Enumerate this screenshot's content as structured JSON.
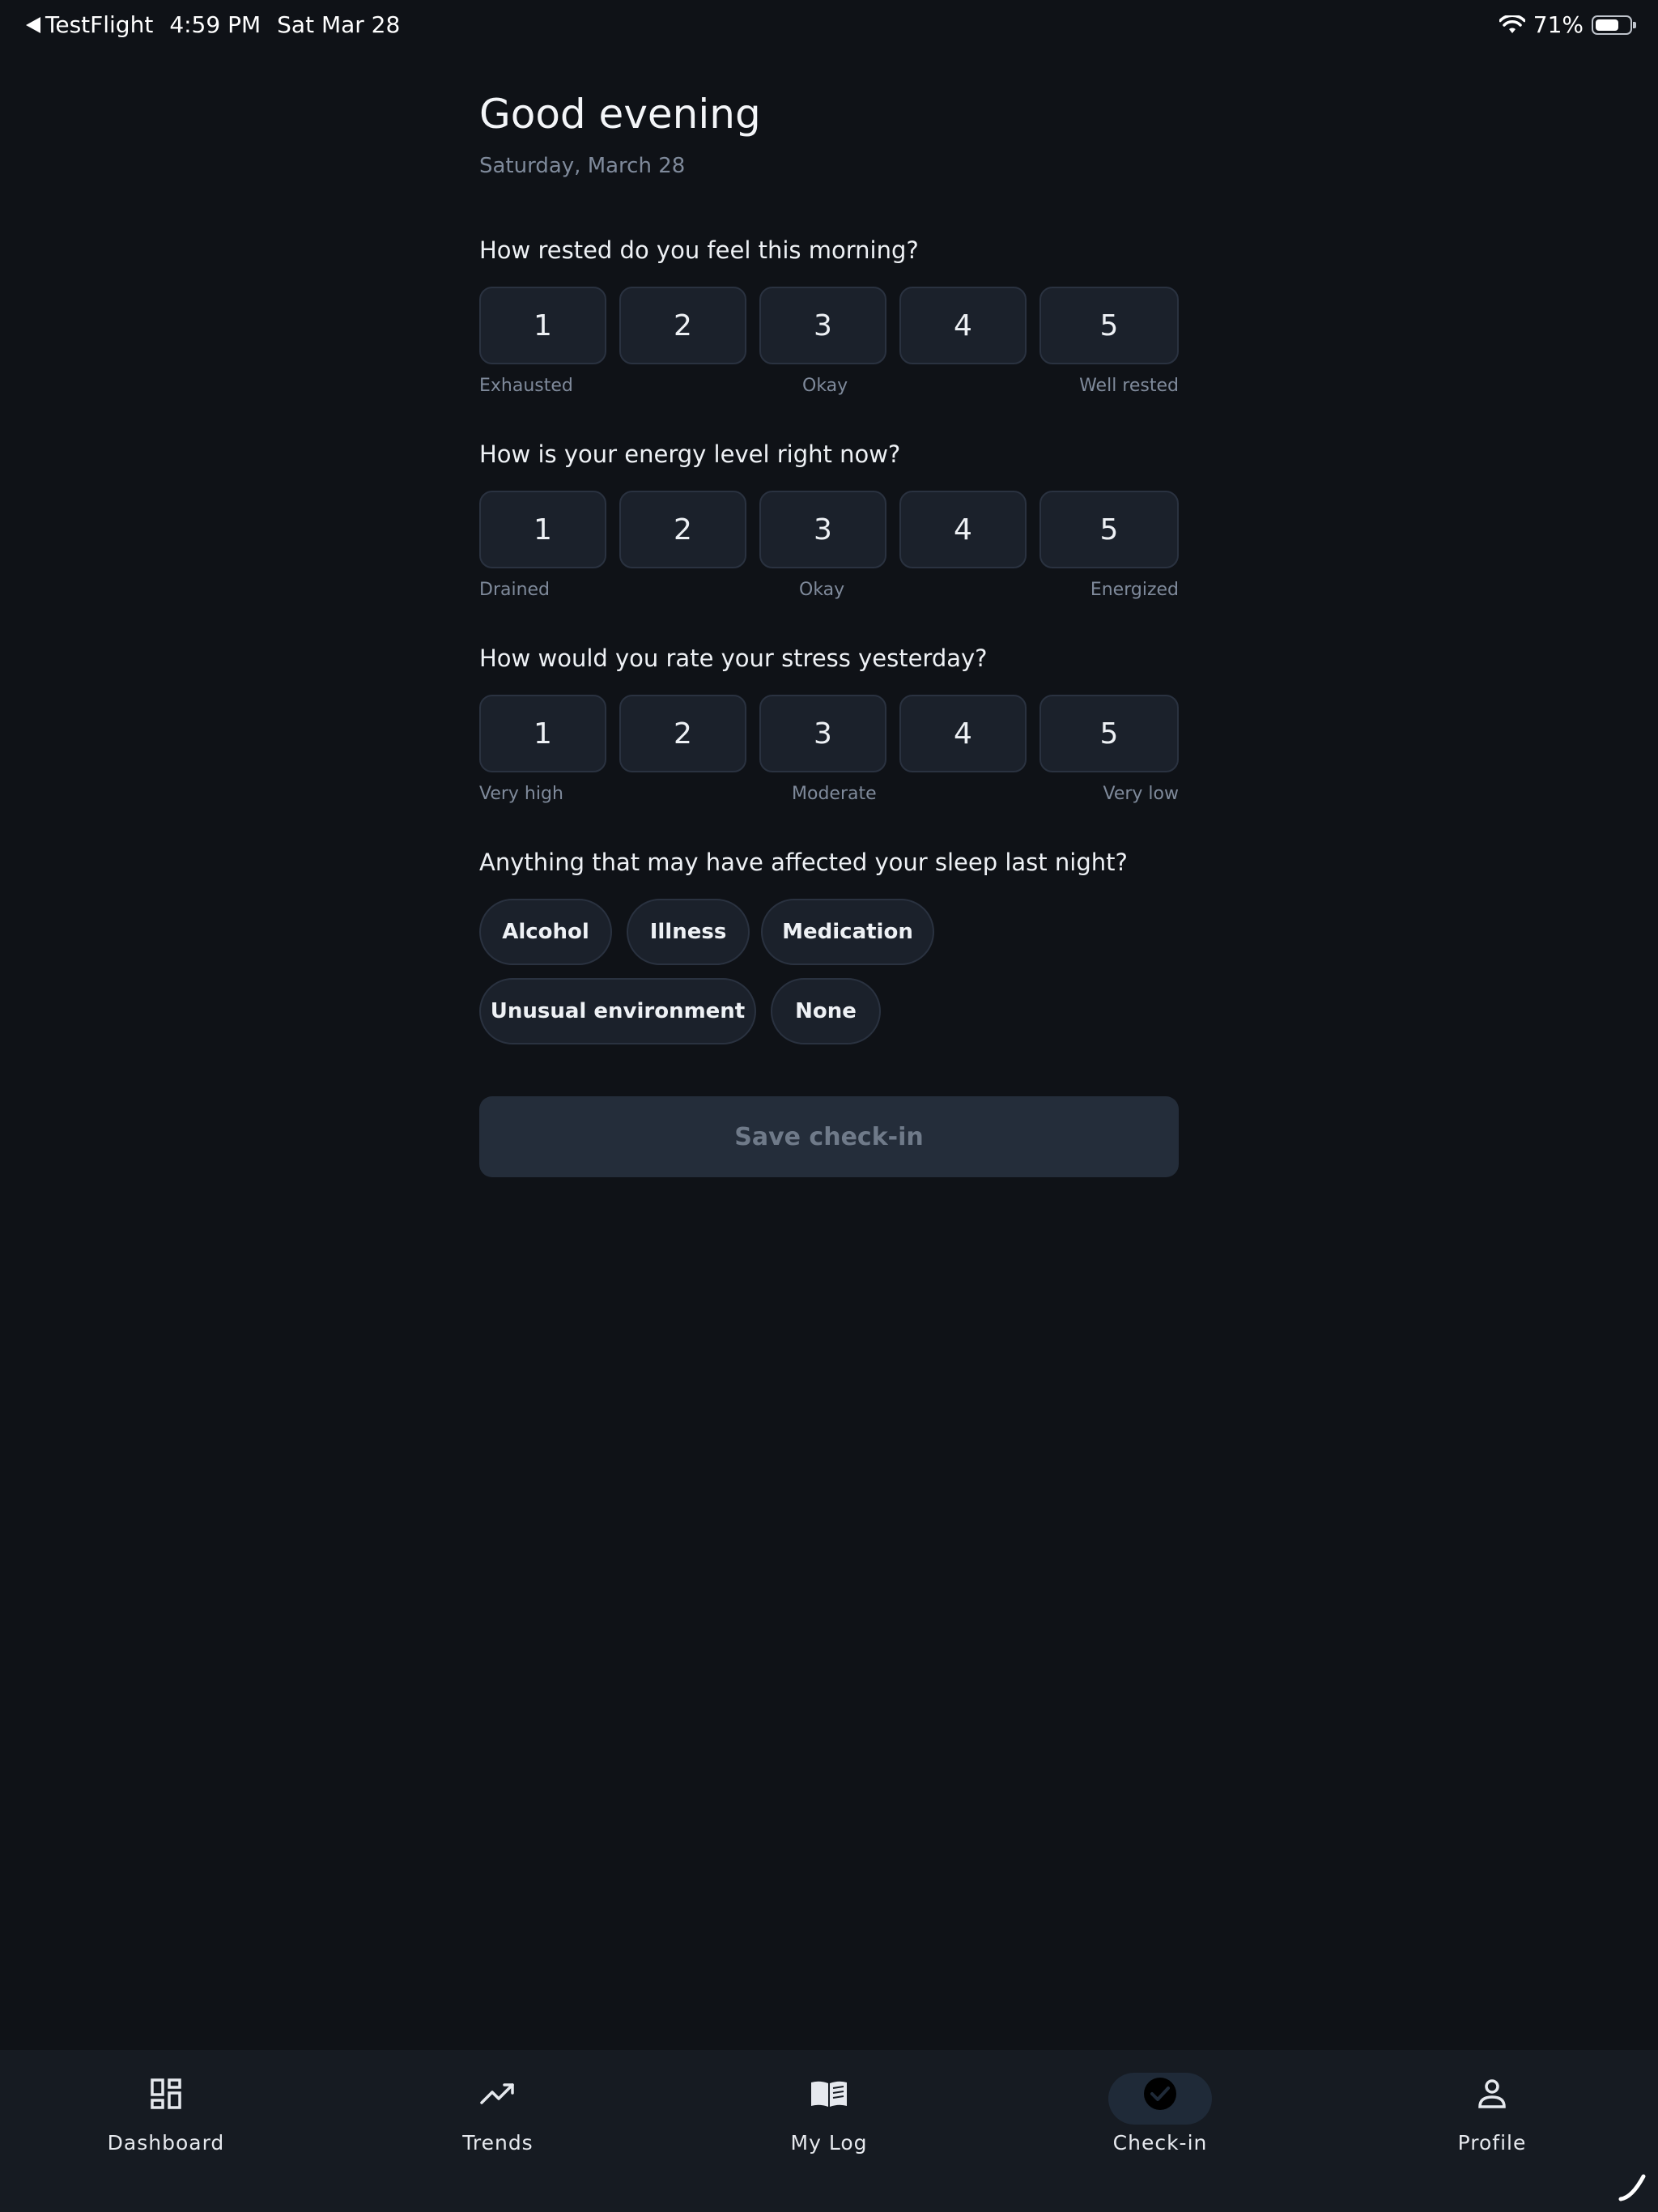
{
  "status_bar": {
    "back_app": "TestFlight",
    "time": "4:59 PM",
    "date": "Sat Mar 28",
    "battery": "71%",
    "battery_level": 0.71
  },
  "header": {
    "greeting": "Good evening",
    "date": "Saturday, March 28"
  },
  "questions": [
    {
      "title": "How rested do you feel this morning?",
      "options": [
        "1",
        "2",
        "3",
        "4",
        "5"
      ],
      "low_label": "Exhausted",
      "mid_label": "Okay",
      "high_label": "Well rested"
    },
    {
      "title": "How is your energy level right now?",
      "options": [
        "1",
        "2",
        "3",
        "4",
        "5"
      ],
      "low_label": "Drained",
      "mid_label": "Okay",
      "high_label": "Energized"
    },
    {
      "title": "How would you rate your stress yesterday?",
      "options": [
        "1",
        "2",
        "3",
        "4",
        "5"
      ],
      "low_label": "Very high",
      "mid_label": "Moderate",
      "high_label": "Very low"
    }
  ],
  "factors": {
    "title": "Anything that may have affected your sleep last night?",
    "chips": [
      "Alcohol",
      "Illness",
      "Medication",
      "Unusual environment",
      "None"
    ]
  },
  "save_button": "Save check-in",
  "tabbar": {
    "items": [
      {
        "label": "Dashboard",
        "icon": "dashboard-icon"
      },
      {
        "label": "Trends",
        "icon": "trending-up-icon"
      },
      {
        "label": "My Log",
        "icon": "book-icon"
      },
      {
        "label": "Check-in",
        "icon": "check-circle-icon",
        "active": true
      },
      {
        "label": "Profile",
        "icon": "person-icon"
      }
    ]
  },
  "colors": {
    "background": "#0f1217",
    "card": "#1b212b",
    "tabbar": "#161b22",
    "muted_text": "#7f8a9b"
  }
}
